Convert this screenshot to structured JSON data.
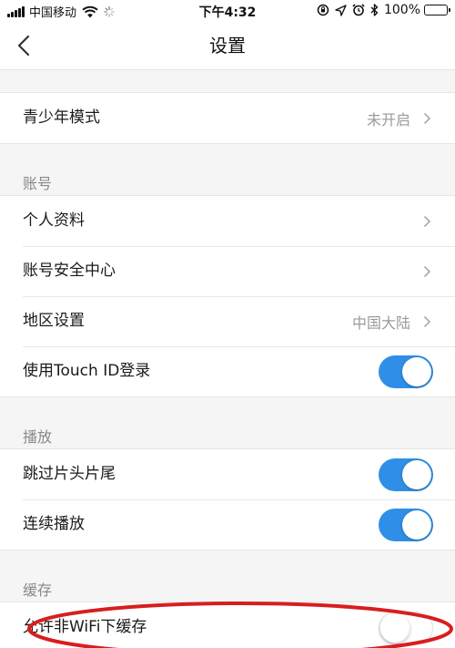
{
  "status_bar": {
    "carrier": "中国移动",
    "time": "下午4:32",
    "battery_percent": "100%"
  },
  "nav": {
    "title": "设置"
  },
  "youth_mode": {
    "label": "青少年模式",
    "value": "未开启"
  },
  "account": {
    "header": "账号",
    "items": [
      {
        "label": "个人资料"
      },
      {
        "label": "账号安全中心"
      },
      {
        "label": "地区设置",
        "value": "中国大陆"
      },
      {
        "label": "使用Touch ID登录",
        "toggle": true
      }
    ]
  },
  "playback": {
    "header": "播放",
    "items": [
      {
        "label": "跳过片头片尾",
        "toggle": true
      },
      {
        "label": "连续播放",
        "toggle": true
      }
    ]
  },
  "cache": {
    "header": "缓存",
    "items": [
      {
        "label": "允许非WiFi下缓存",
        "toggle": false
      }
    ]
  },
  "colors": {
    "toggle_on": "#2f8fe6",
    "annotation": "#d81e1e"
  }
}
